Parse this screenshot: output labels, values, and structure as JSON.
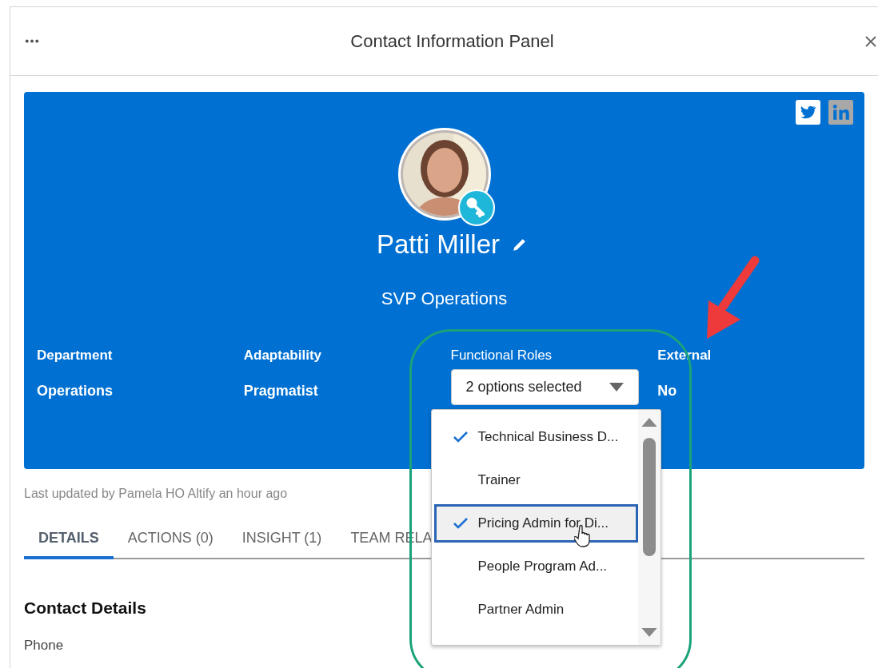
{
  "window": {
    "title": "Contact Information Panel"
  },
  "contact": {
    "name": "Patti Miller",
    "title": "SVP Operations"
  },
  "fields": [
    {
      "kind": "text",
      "label": "Department",
      "value": "Operations"
    },
    {
      "kind": "text",
      "label": "Adaptability",
      "value": "Pragmatist"
    },
    {
      "kind": "multiselect",
      "label": "Functional Roles",
      "value": "2 options selected",
      "expanded": true,
      "options": [
        {
          "label": "Technical Business D...",
          "selected": true,
          "focused": false
        },
        {
          "label": "Trainer",
          "selected": false,
          "focused": false
        },
        {
          "label": "Pricing Admin for Di...",
          "selected": true,
          "focused": true
        },
        {
          "label": "People Program Ad...",
          "selected": false,
          "focused": false
        },
        {
          "label": "Partner Admin",
          "selected": false,
          "focused": false
        }
      ]
    },
    {
      "kind": "text",
      "label": "External",
      "value": "No"
    }
  ],
  "last_updated": "Last updated by Pamela HO Altify an hour ago",
  "tabs": [
    {
      "label": "DETAILS",
      "selected": true
    },
    {
      "label": "ACTIONS (0)",
      "selected": false
    },
    {
      "label": "INSIGHT (1)",
      "selected": false
    },
    {
      "label": "TEAM RELA",
      "selected": false
    }
  ],
  "section": {
    "title": "Contact Details",
    "labels": [
      "Phone"
    ]
  }
}
